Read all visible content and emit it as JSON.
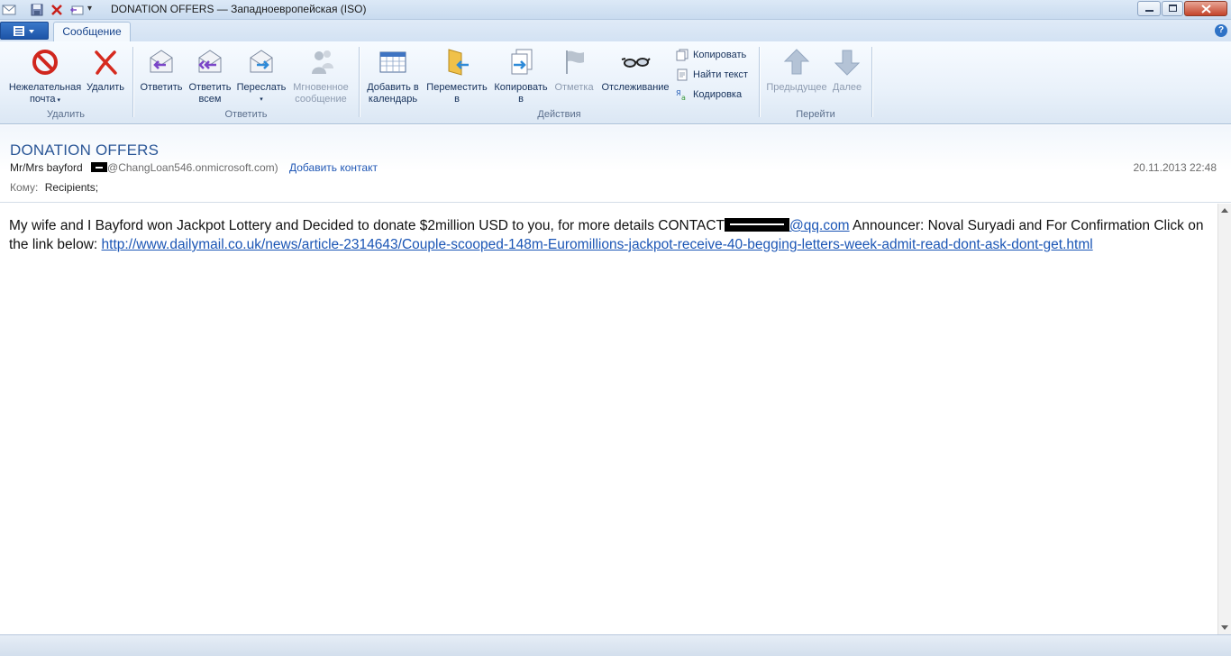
{
  "window": {
    "title": "DONATION OFFERS — Западноевропейская (ISO)"
  },
  "tabs": {
    "message_tab": "Сообщение",
    "help": "?"
  },
  "ribbon": {
    "junk_line1": "Нежелательная",
    "junk_line2": "почта",
    "delete": "Удалить",
    "group_delete": "Удалить",
    "reply": "Ответить",
    "reply_all_line1": "Ответить",
    "reply_all_line2": "всем",
    "forward": "Переслать",
    "im_line1": "Мгновенное",
    "im_line2": "сообщение",
    "group_reply": "Ответить",
    "add_calendar_line1": "Добавить в",
    "add_calendar_line2": "календарь",
    "move_line1": "Переместить",
    "move_line2": "в",
    "copy_line1": "Копировать",
    "copy_line2": "в",
    "flag": "Отметка",
    "watch": "Отслеживание",
    "copy_small": "Копировать",
    "find_text": "Найти текст",
    "encoding": "Кодировка",
    "group_actions": "Действия",
    "previous": "Предыдущее",
    "next": "Далее",
    "group_navigate": "Перейти"
  },
  "message": {
    "subject": "DONATION OFFERS",
    "sender_name": "Mr/Mrs bayford",
    "sender_domain": "@ChangLoan546.onmicrosoft.com)",
    "add_contact": "Добавить контакт",
    "date": "20.11.2013 22:48",
    "to_label": "Кому:",
    "to_value": "Recipients;",
    "body_part1": "My wife and I Bayford won Jackpot Lottery and Decided to donate $2million USD to you, for more details CONTACT",
    "email_domain": "@qq.com",
    "body_part2": " Announcer: Noval Suryadi and For Confirmation Click on the link below: ",
    "link": "http://www.dailymail.co.uk/news/article-2314643/Couple-scooped-148m-Euromillions-jackpot-receive-40-begging-letters-week-admit-read-dont-ask-dont-get.html"
  }
}
